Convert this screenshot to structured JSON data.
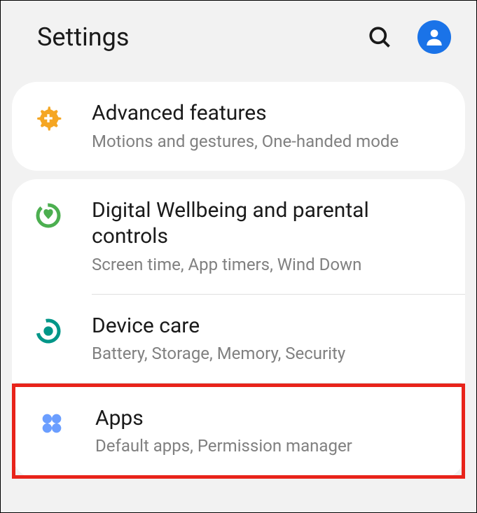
{
  "header": {
    "title": "Settings"
  },
  "groups": [
    {
      "items": [
        {
          "id": "advanced-features",
          "title": "Advanced features",
          "subtitle": "Motions and gestures, One-handed mode",
          "icon": "gear-plus"
        }
      ]
    },
    {
      "items": [
        {
          "id": "digital-wellbeing",
          "title": "Digital Wellbeing and parental controls",
          "subtitle": "Screen time, App timers, Wind Down",
          "icon": "wellbeing"
        },
        {
          "id": "device-care",
          "title": "Device care",
          "subtitle": "Battery, Storage, Memory, Security",
          "icon": "device-care"
        },
        {
          "id": "apps",
          "title": "Apps",
          "subtitle": "Default apps, Permission manager",
          "icon": "apps-grid",
          "highlighted": true
        }
      ]
    }
  ]
}
